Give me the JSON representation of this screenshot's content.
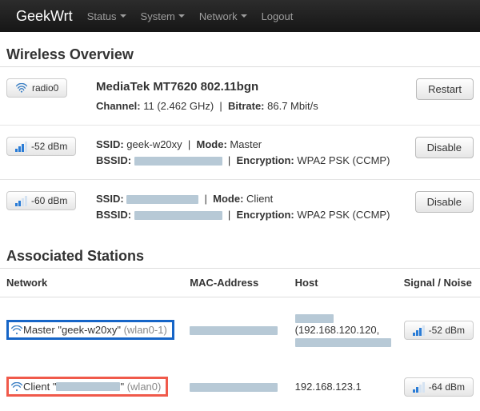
{
  "navbar": {
    "brand": "GeekWrt",
    "items": [
      "Status",
      "System",
      "Network",
      "Logout"
    ]
  },
  "overview": {
    "heading": "Wireless Overview",
    "radio_button": "radio0",
    "hardware": "MediaTek MT7620 802.11bgn",
    "channel_label": "Channel:",
    "channel_value": "11 (2.462 GHz)",
    "bitrate_label": "Bitrate:",
    "bitrate_value": "86.7 Mbit/s",
    "restart_label": "Restart",
    "ssids": [
      {
        "signal": "-52 dBm",
        "ssid_label": "SSID:",
        "ssid_value": "geek-w20xy",
        "mode_label": "Mode:",
        "mode_value": "Master",
        "bssid_label": "BSSID:",
        "encryption_label": "Encryption:",
        "encryption_value": "WPA2 PSK (CCMP)",
        "action": "Disable"
      },
      {
        "signal": "-60 dBm",
        "ssid_label": "SSID:",
        "mode_label": "Mode:",
        "mode_value": "Client",
        "bssid_label": "BSSID:",
        "encryption_label": "Encryption:",
        "encryption_value": "WPA2 PSK (CCMP)",
        "action": "Disable"
      }
    ]
  },
  "stations": {
    "heading": "Associated Stations",
    "cols": [
      "Network",
      "MAC-Address",
      "Host",
      "Signal / Noise"
    ],
    "rows": [
      {
        "net_prefix": "Master \"",
        "net_name": "geek-w20xy",
        "net_suffix": "\"",
        "iface": "(wlan0-1)",
        "host_ip": "(192.168.120.120,",
        "signal": "-52 dBm"
      },
      {
        "net_prefix": "Client \"",
        "net_suffix": "\"",
        "iface": "(wlan0)",
        "host_ip": "192.168.123.1",
        "signal": "-64 dBm"
      }
    ]
  }
}
